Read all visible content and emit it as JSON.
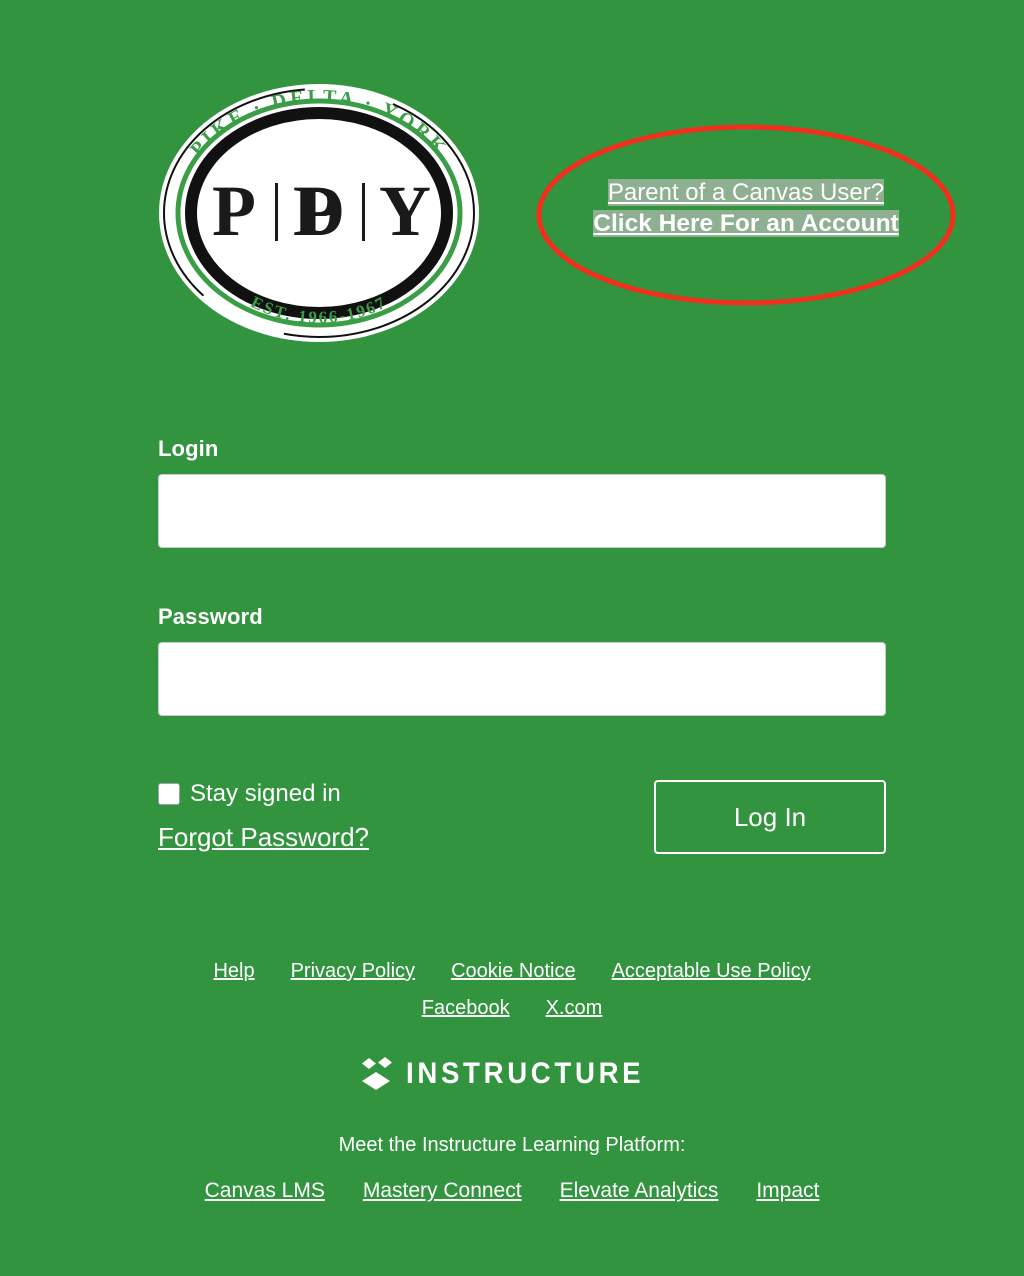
{
  "page": {
    "background_color": "#339440",
    "text_color": "#ffffff"
  },
  "logo": {
    "name": "pike-delta-york-seal",
    "arc_top": "PIKE  ·  DELTA  ·  YORK",
    "arc_top_words": [
      "PIKE",
      "DELTA",
      "YORK"
    ],
    "center": "P|D|Y",
    "center_letters": [
      "P",
      "D",
      "Y"
    ],
    "arc_bottom": "EST. 1966-1967",
    "ring_green": "#3a9e47",
    "ring_black": "#111111",
    "field_white": "#ffffff"
  },
  "parent_promo": {
    "line1": "Parent of a Canvas User?",
    "line2": "Click Here For an Account",
    "highlight_color": "#8FAF93",
    "annotation_color": "#F22E1C",
    "annotation_shape": "ellipse"
  },
  "form": {
    "login_label": "Login",
    "login_value": "",
    "login_placeholder": "",
    "password_label": "Password",
    "password_value": "",
    "password_placeholder": "",
    "stay_signed_in_label": "Stay signed in",
    "stay_signed_in_checked": false,
    "forgot_password_label": "Forgot Password?",
    "login_button_label": "Log In"
  },
  "footer": {
    "primary_links": [
      {
        "label": "Help"
      },
      {
        "label": "Privacy Policy"
      },
      {
        "label": "Cookie Notice"
      },
      {
        "label": "Acceptable Use Policy"
      }
    ],
    "social_links": [
      {
        "label": "Facebook"
      },
      {
        "label": "X.com"
      }
    ],
    "brand": "INSTRUCTURE",
    "tagline": "Meet the Instructure Learning Platform:",
    "platform_links": [
      {
        "label": "Canvas LMS"
      },
      {
        "label": "Mastery Connect"
      },
      {
        "label": "Elevate Analytics"
      },
      {
        "label": "Impact"
      }
    ]
  }
}
